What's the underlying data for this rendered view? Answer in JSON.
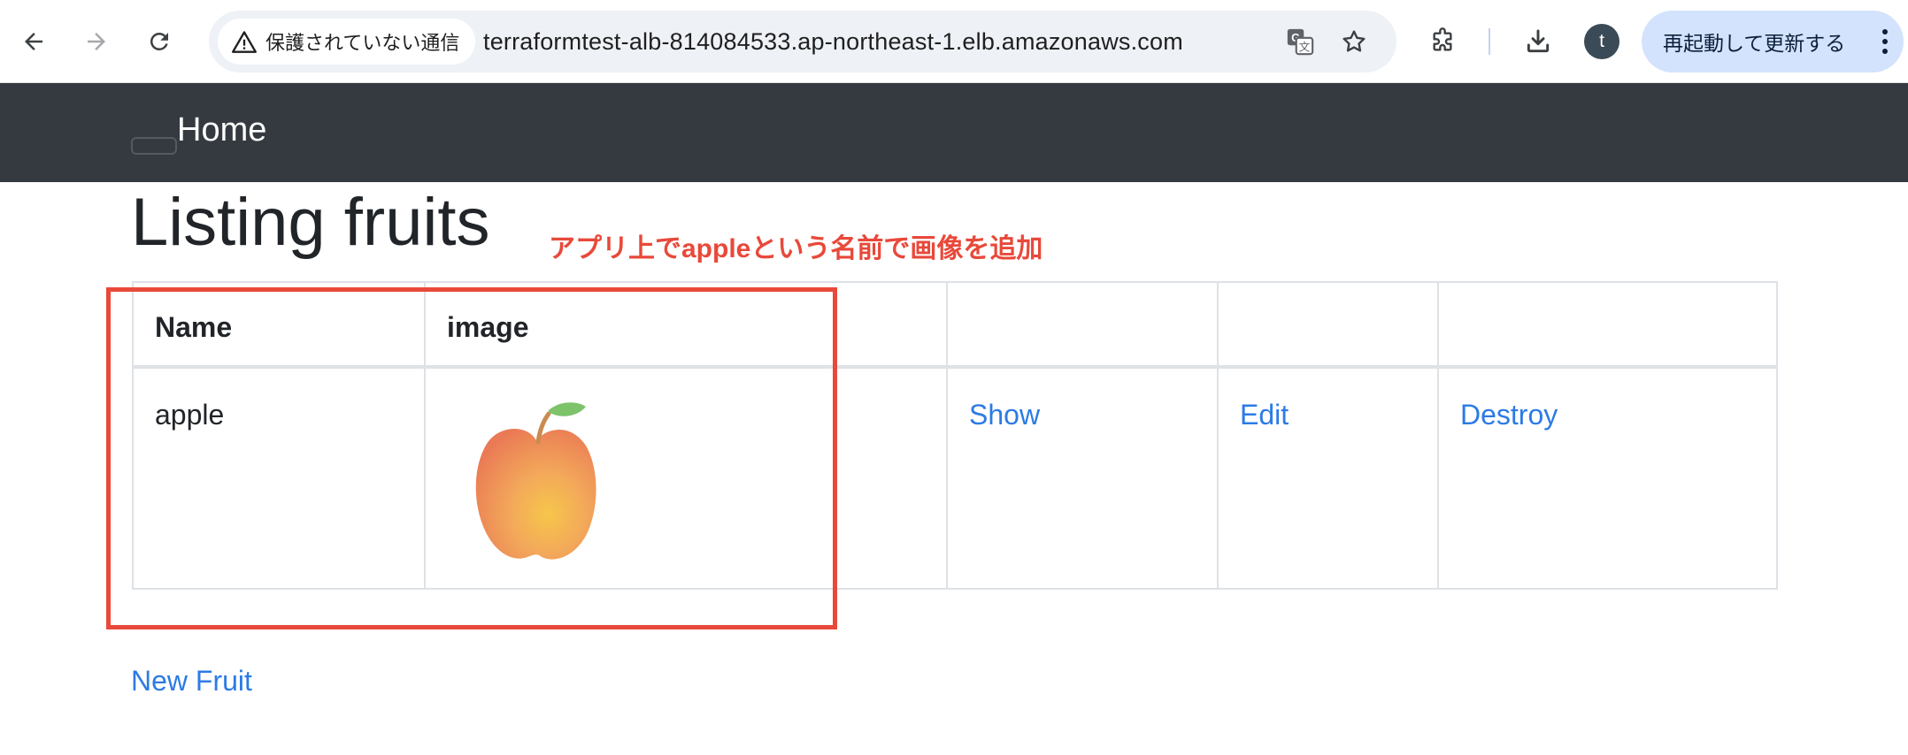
{
  "browser": {
    "security_label": "保護されていない通信",
    "url": "terraformtest-alb-814084533.ap-northeast-1.elb.amazonaws.com",
    "profile_initial": "t",
    "update_button_label": "再起動して更新する",
    "icons": [
      "back-icon",
      "forward-icon",
      "reload-icon",
      "warning-icon",
      "translate-icon",
      "star-icon",
      "extensions-icon",
      "download-icon",
      "more-menu-icon"
    ]
  },
  "navbar": {
    "brand": "Home"
  },
  "page": {
    "title": "Listing fruits",
    "annotation": "アプリ上でappleという名前で画像を追加",
    "new_link": "New Fruit"
  },
  "table": {
    "headers": [
      "Name",
      "image",
      "",
      "",
      ""
    ],
    "rows": [
      {
        "name": "apple",
        "image": "apple-illustration",
        "show": "Show",
        "edit": "Edit",
        "destroy": "Destroy"
      }
    ]
  },
  "colors": {
    "navbar_bg": "#343a40",
    "link": "#2c7be5",
    "annotation_red": "#e8493a",
    "update_button_bg": "#d3e3fd"
  }
}
